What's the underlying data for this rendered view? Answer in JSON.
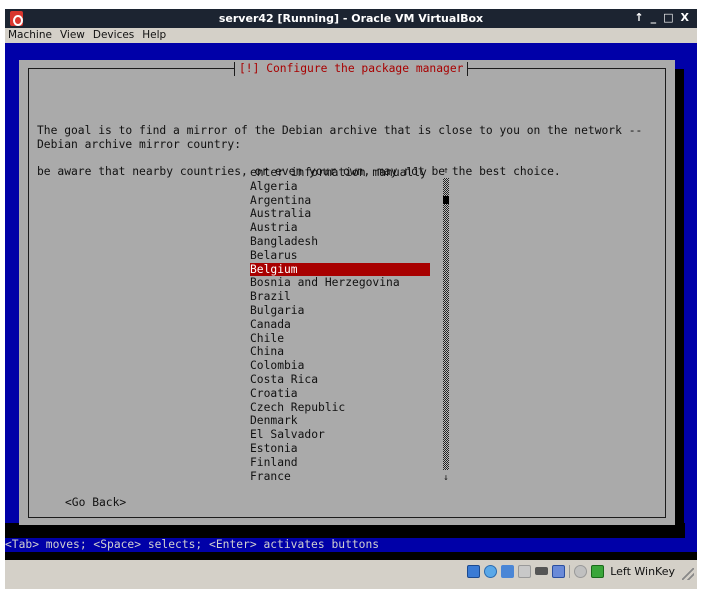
{
  "window": {
    "title": "server42 [Running] - Oracle VM VirtualBox",
    "controls": [
      "↑",
      "_",
      "□",
      "X"
    ]
  },
  "menubar": [
    "Machine",
    "View",
    "Devices",
    "Help"
  ],
  "installer": {
    "dialog_title": "[!] Configure the package manager",
    "description_line1": "The goal is to find a mirror of the Debian archive that is close to you on the network --",
    "description_line2": "be aware that nearby countries, or even your own, may not be the best choice.",
    "prompt": "Debian archive mirror country:",
    "countries": [
      "enter information manually",
      "Algeria",
      "Argentina",
      "Australia",
      "Austria",
      "Bangladesh",
      "Belarus",
      "Belgium",
      "Bosnia and Herzegovina",
      "Brazil",
      "Bulgaria",
      "Canada",
      "Chile",
      "China",
      "Colombia",
      "Costa Rica",
      "Croatia",
      "Czech Republic",
      "Denmark",
      "El Salvador",
      "Estonia",
      "Finland",
      "France"
    ],
    "selected_country": "Belgium",
    "scroll_up": "↑",
    "scroll_down": "↓",
    "go_back_label": "<Go Back>",
    "help_line": "<Tab> moves; <Space> selects; <Enter> activates buttons",
    "colors": {
      "screen_bg": "#0000a8",
      "dialog_bg": "#aaaaaa",
      "title_fg": "#a80000",
      "selection_bg": "#a80000"
    }
  },
  "statusbar": {
    "icons": [
      "hard-disk-icon",
      "optical-drive-icon",
      "network-icon",
      "shared-folder-icon",
      "video-capture-icon",
      "usb-icon",
      "mouse-integration-icon",
      "keyboard-capture-icon"
    ],
    "host_key": "Left WinKey"
  }
}
